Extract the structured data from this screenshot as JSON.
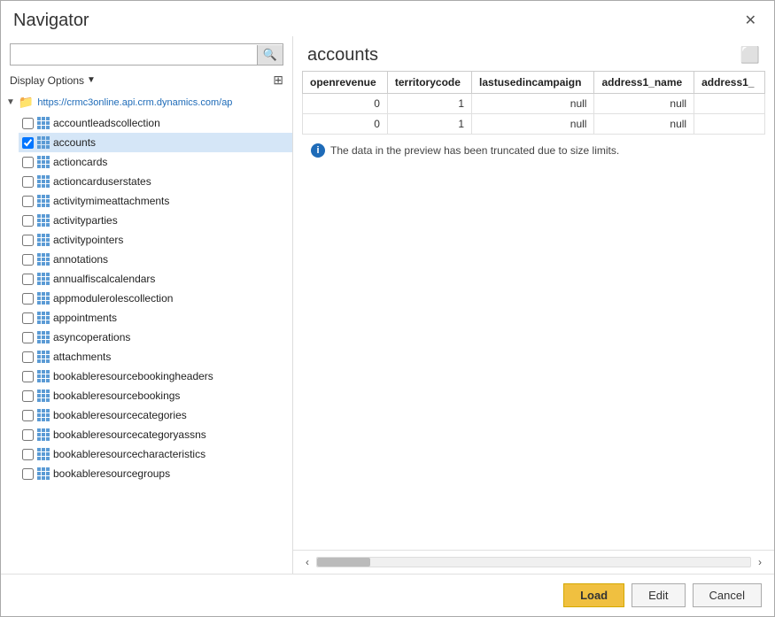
{
  "dialog": {
    "title": "Navigator",
    "close_label": "✕"
  },
  "left_panel": {
    "search_placeholder": "",
    "display_options_label": "Display Options",
    "display_options_arrow": "▼",
    "tree": {
      "root_url": "https://crmc3online.api.crm.dynamics.com/ap",
      "items": [
        {
          "id": "accountleadscollection",
          "label": "accountleadscollection",
          "checked": false,
          "selected": false
        },
        {
          "id": "accounts",
          "label": "accounts",
          "checked": true,
          "selected": true
        },
        {
          "id": "actioncards",
          "label": "actioncards",
          "checked": false,
          "selected": false
        },
        {
          "id": "actioncarduserstates",
          "label": "actioncarduserstates",
          "checked": false,
          "selected": false
        },
        {
          "id": "activitymimeattachments",
          "label": "activitymimeattachments",
          "checked": false,
          "selected": false
        },
        {
          "id": "activityparties",
          "label": "activityparties",
          "checked": false,
          "selected": false
        },
        {
          "id": "activitypointers",
          "label": "activitypointers",
          "checked": false,
          "selected": false
        },
        {
          "id": "annotations",
          "label": "annotations",
          "checked": false,
          "selected": false
        },
        {
          "id": "annualfiscalcalendars",
          "label": "annualfiscalcalendars",
          "checked": false,
          "selected": false
        },
        {
          "id": "appmodulerolescollection",
          "label": "appmodulerolescollection",
          "checked": false,
          "selected": false
        },
        {
          "id": "appointments",
          "label": "appointments",
          "checked": false,
          "selected": false
        },
        {
          "id": "asyncoperations",
          "label": "asyncoperations",
          "checked": false,
          "selected": false
        },
        {
          "id": "attachments",
          "label": "attachments",
          "checked": false,
          "selected": false
        },
        {
          "id": "bookableresourcebookingheaders",
          "label": "bookableresourcebookingheaders",
          "checked": false,
          "selected": false
        },
        {
          "id": "bookableresourcebookings",
          "label": "bookableresourcebookings",
          "checked": false,
          "selected": false
        },
        {
          "id": "bookableresourcecategories",
          "label": "bookableresourcecategories",
          "checked": false,
          "selected": false
        },
        {
          "id": "bookableresourcecategoryassns",
          "label": "bookableresourcecategoryassns",
          "checked": false,
          "selected": false
        },
        {
          "id": "bookableresourcecharacteristics",
          "label": "bookableresourcecharacteristics",
          "checked": false,
          "selected": false
        },
        {
          "id": "bookableresourcegroups",
          "label": "bookableresourcegroups",
          "checked": false,
          "selected": false
        }
      ]
    }
  },
  "right_panel": {
    "preview_title": "accounts",
    "table": {
      "columns": [
        "openrevenue",
        "territorycode",
        "lastusedincampaign",
        "address1_name",
        "address1_"
      ],
      "rows": [
        [
          "0",
          "1",
          "null",
          "null",
          ""
        ],
        [
          "0",
          "1",
          "null",
          "null",
          ""
        ]
      ]
    },
    "truncate_notice": "The data in the preview has been truncated due to size limits."
  },
  "footer": {
    "load_label": "Load",
    "edit_label": "Edit",
    "cancel_label": "Cancel"
  }
}
